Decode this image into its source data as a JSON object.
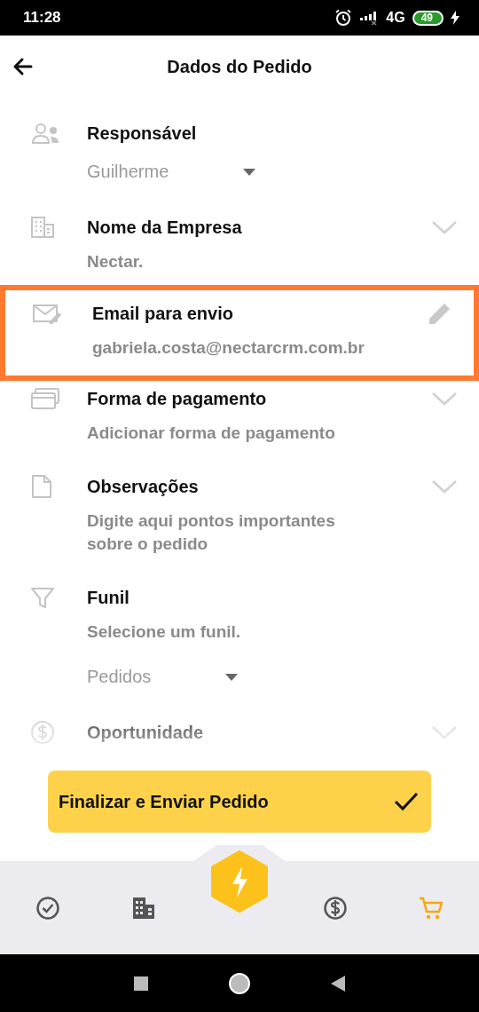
{
  "status_bar": {
    "time": "11:28",
    "network": "4G",
    "battery": "49"
  },
  "header": {
    "title": "Dados do Pedido"
  },
  "fields": [
    {
      "kind": "dropdown",
      "label": "Responsável",
      "select": "Guilherme",
      "highlighted": false
    },
    {
      "kind": "expandable",
      "label": "Nome da Empresa",
      "value": "Nectar.",
      "highlighted": false
    },
    {
      "kind": "editable",
      "label": "Email para envio",
      "value": "gabriela.costa@nectarcrm.com.br",
      "highlighted": true
    },
    {
      "kind": "expandable",
      "label": "Forma de pagamento",
      "value": "Adicionar forma de pagamento",
      "highlighted": false
    },
    {
      "kind": "expandable",
      "label": "Observações",
      "value": "Digite aqui pontos importantes sobre o pedido",
      "highlighted": false
    },
    {
      "kind": "dropdown",
      "label": "Funil",
      "value": "Selecione um funil.",
      "select": "Pedidos",
      "highlighted": false
    },
    {
      "kind": "expandable",
      "label": "Oportunidade",
      "highlighted": false
    }
  ],
  "submit_button": {
    "label": "Finalizar e Enviar Pedido"
  },
  "bottom_nav": [
    {
      "kind": "tasks",
      "selected": false
    },
    {
      "kind": "companies",
      "selected": false
    },
    {
      "kind": "action",
      "selected": false
    },
    {
      "kind": "deals",
      "selected": false
    },
    {
      "kind": "cart",
      "selected": true
    }
  ]
}
